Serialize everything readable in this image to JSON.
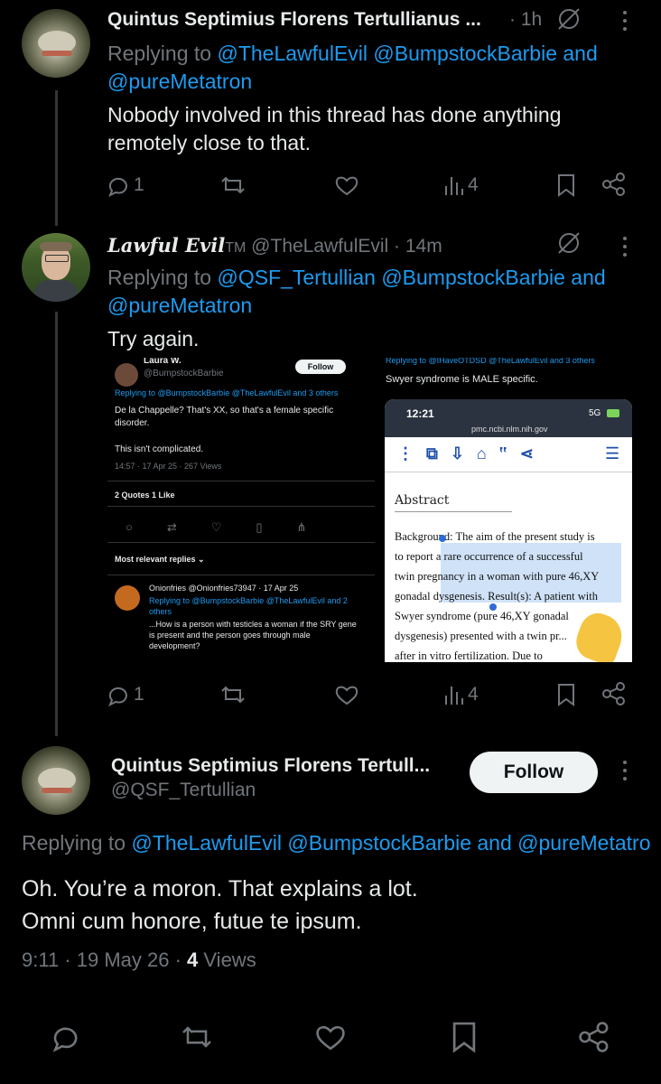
{
  "tweet1": {
    "author": "Quintus Septimius Florens Tertullianus ...",
    "time": "· 1h",
    "replying_prefix": "Replying to",
    "reply_handles": "@TheLawfulEvil @BumpstockBarbie and",
    "reply_handles2": "@pureMetatron",
    "text_line1": "Nobody involved in this thread has done anything",
    "text_line2": "remotely close to that.",
    "replies": "1",
    "views": "4"
  },
  "tweet2": {
    "author": "Lawful Evil",
    "author_tm": "TM",
    "handle_time": "@TheLawfulEvil · 14m",
    "replying_prefix": "Replying to",
    "reply_handles": "@QSF_Tertullian @BumpstockBarbie and",
    "reply_handles2": "@pureMetatron",
    "text": "Try again.",
    "replies": "1",
    "views": "4",
    "embed_left": {
      "name": "Laura W.",
      "handle": "@BumpstockBarbie",
      "follow": "Follow",
      "replying": "Replying to @BumpstockBarbie @TheLawfulEvil and 3 others",
      "line1": "De la Chappelle? That's XX, so that's a female specific",
      "line2": "disorder.",
      "line3": "This isn't complicated.",
      "meta": "14:57 · 17 Apr 25 · 267 Views",
      "quotes": "2 Quotes   1 Like",
      "most_relevant": "Most relevant replies ⌄",
      "reply_name": "Onionfries @Onionfries73947 · 17 Apr 25",
      "reply_to": "Replying to @BumpstockBarbie @TheLawfulEvil and 2",
      "reply_to2": "others",
      "reply_l1": "...How is a person with testicles a woman if the SRY gene",
      "reply_l2": "is present and the person goes through male",
      "reply_l3": "development?"
    },
    "embed_right": {
      "top_cut": "Replying to @IHaveOTDSD @TheLawfulEvil and 3 others",
      "line": "Swyer syndrome is MALE specific.",
      "clock": "12:21",
      "signal": "5G",
      "url": "pmc.ncbi.nlm.nih.gov",
      "abstract": "Abstract",
      "p1": "Background: The aim of the present study is",
      "p2": "to report a rare occurrence of a successful",
      "p3": "twin pregnancy in a woman with pure 46,XY",
      "p4": "gonadal dysgenesis. Result(s): A patient with",
      "p5": "Swyer syndrome (pure 46,XY gonadal",
      "p6": "dysgenesis) presented with a twin pr...",
      "p7": "after in vitro fertilization. Due to"
    }
  },
  "tweet3": {
    "author": "Quintus Septimius Florens Tertull...",
    "handle": "@QSF_Tertullian",
    "follow": "Follow",
    "replying_prefix": "Replying to",
    "reply_handles": "@TheLawfulEvil @BumpstockBarbie and @pureMetatro",
    "text_line1": "Oh. You’re a moron. That explains a lot.",
    "text_line2": "Omni cum honore, futue te ipsum.",
    "time": "9:11 · 19 May 26 ·",
    "views_count": "4",
    "views_label": "Views"
  },
  "colors": {
    "background": "#000000",
    "text": "#e7e9ea",
    "muted": "#71767b",
    "link": "#1d9bf0"
  }
}
